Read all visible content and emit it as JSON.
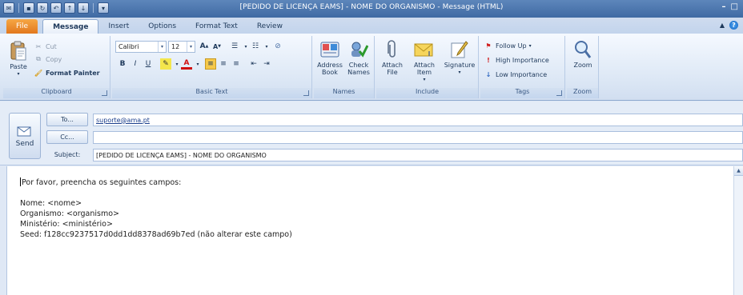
{
  "window": {
    "title": "[PEDIDO DE LICENÇA EAMS] - NOME DO ORGANISMO - Message (HTML)"
  },
  "tabs": [
    {
      "label": "File"
    },
    {
      "label": "Message"
    },
    {
      "label": "Insert"
    },
    {
      "label": "Options"
    },
    {
      "label": "Format Text"
    },
    {
      "label": "Review"
    }
  ],
  "ribbon": {
    "clipboard": {
      "paste": "Paste",
      "cut": "Cut",
      "copy": "Copy",
      "format_painter": "Format Painter",
      "label": "Clipboard"
    },
    "basic_text": {
      "font": "Calibri",
      "size": "12",
      "bold": "B",
      "italic": "I",
      "underline": "U",
      "label": "Basic Text"
    },
    "names": {
      "address_book": "Address Book",
      "check_names": "Check Names",
      "label": "Names"
    },
    "include": {
      "attach_file": "Attach File",
      "attach_item": "Attach Item",
      "signature": "Signature",
      "label": "Include"
    },
    "tags": {
      "follow_up": "Follow Up",
      "high_importance": "High Importance",
      "low_importance": "Low Importance",
      "label": "Tags"
    },
    "zoom": {
      "zoom": "Zoom",
      "label": "Zoom"
    }
  },
  "header": {
    "send": "Send",
    "to_label": "To...",
    "to_value": "suporte@ama.pt",
    "cc_label": "Cc...",
    "cc_value": "",
    "subject_label": "Subject:",
    "subject_value": "[PEDIDO DE LICENÇA EAMS] - NOME DO ORGANISMO"
  },
  "body": {
    "line1": "Por favor, preencha os seguintes campos:",
    "line2": "Nome: <nome>",
    "line3": "Organismo: <organismo>",
    "line4": "Ministério: <ministério>",
    "line5": "Seed: f128cc9237517d0dd1dd8378ad69b7ed (não alterar este campo)"
  }
}
